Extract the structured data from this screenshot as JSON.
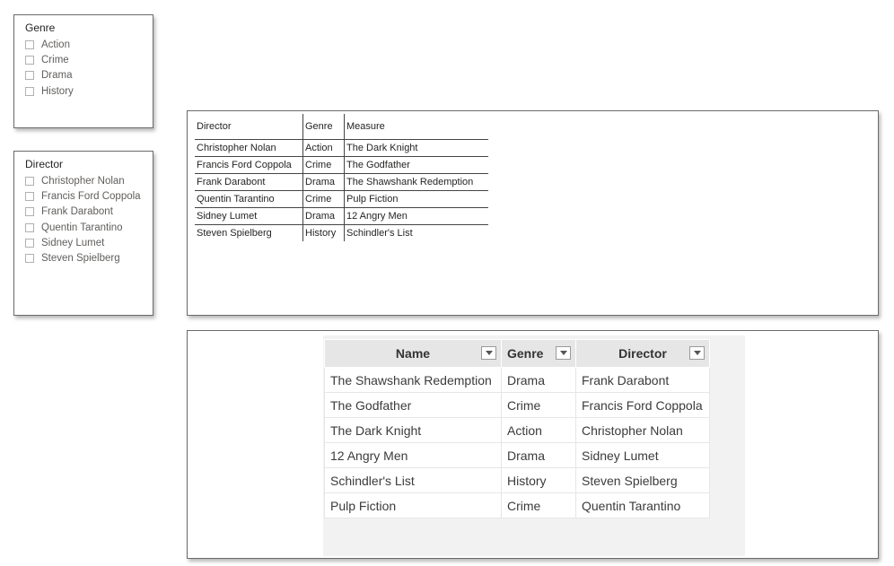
{
  "genre_slicer": {
    "title": "Genre",
    "items": [
      "Action",
      "Crime",
      "Drama",
      "History"
    ]
  },
  "director_slicer": {
    "title": "Director",
    "items": [
      "Christopher Nolan",
      "Francis Ford Coppola",
      "Frank Darabont",
      "Quentin Tarantino",
      "Sidney Lumet",
      "Steven Spielberg"
    ]
  },
  "matrix": {
    "headers": [
      "Director",
      "Genre",
      "Measure"
    ],
    "rows": [
      [
        "Christopher Nolan",
        "Action",
        "The Dark Knight"
      ],
      [
        "Francis Ford Coppola",
        "Crime",
        "The Godfather"
      ],
      [
        "Frank Darabont",
        "Drama",
        "The Shawshank Redemption"
      ],
      [
        "Quentin Tarantino",
        "Crime",
        "Pulp Fiction"
      ],
      [
        "Sidney Lumet",
        "Drama",
        "12 Angry Men"
      ],
      [
        "Steven Spielberg",
        "History",
        "Schindler's List"
      ]
    ]
  },
  "source_table": {
    "headers": [
      "Name",
      "Genre",
      "Director"
    ],
    "rows": [
      [
        "The Shawshank Redemption",
        "Drama",
        "Frank Darabont"
      ],
      [
        "The Godfather",
        "Crime",
        "Francis Ford Coppola"
      ],
      [
        "The Dark Knight",
        "Action",
        "Christopher Nolan"
      ],
      [
        "12 Angry Men",
        "Drama",
        "Sidney Lumet"
      ],
      [
        "Schindler's List",
        "History",
        "Steven Spielberg"
      ],
      [
        "Pulp Fiction",
        "Crime",
        "Quentin Tarantino"
      ]
    ]
  }
}
